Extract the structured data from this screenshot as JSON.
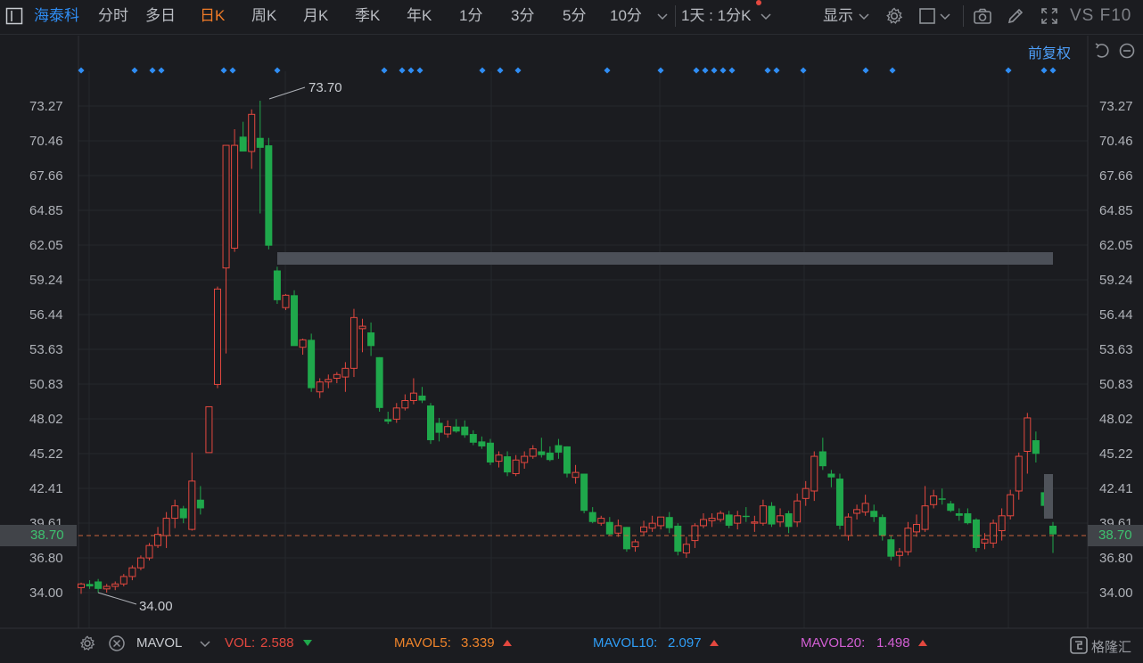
{
  "toolbar": {
    "stock_name": "海泰科",
    "periods": [
      "分时",
      "多日",
      "日K",
      "周K",
      "月K",
      "季K",
      "年K",
      "1分",
      "3分",
      "5分",
      "10分"
    ],
    "active_period": "日K",
    "custom_period": "1天 : 1分K",
    "display_label": "显示",
    "f10_label": "VS F10"
  },
  "adjust_label": "前复权",
  "price_axis": {
    "labels": [
      "73.27",
      "70.46",
      "67.66",
      "64.85",
      "62.05",
      "59.24",
      "56.44",
      "53.63",
      "50.83",
      "48.02",
      "45.22",
      "42.41",
      "39.61",
      "36.80",
      "34.00"
    ]
  },
  "current_price": "38.70",
  "annotations": {
    "high": "73.70",
    "low": "34.00"
  },
  "indicators": {
    "name": "MAVOL",
    "vol_label": "VOL:",
    "vol_value": "2.588",
    "mavol5_label": "MAVOL5:",
    "mavol5_value": "3.339",
    "mavol10_label": "MAVOL10:",
    "mavol10_value": "2.097",
    "mavol20_label": "MAVOL20:",
    "mavol20_value": "1.498",
    "colors": {
      "vol": "#e4483f",
      "mavol5": "#f0842a",
      "mavol10": "#2f9df6",
      "mavol20": "#d35fd4"
    }
  },
  "brand": "格隆汇",
  "colors": {
    "up": "#e4483f",
    "down": "#1fa84b",
    "accent": "#f07b27",
    "blue": "#2f8df4",
    "background": "#1b1c20"
  },
  "chart_data": {
    "type": "candlestick",
    "ylim": [
      34.0,
      73.27
    ],
    "candles": [
      {
        "o": 34.4,
        "h": 34.8,
        "l": 33.9,
        "c": 34.7
      },
      {
        "o": 34.7,
        "h": 35.0,
        "l": 34.3,
        "c": 34.5
      },
      {
        "o": 34.9,
        "h": 35.1,
        "l": 34.0,
        "c": 34.3
      },
      {
        "o": 34.3,
        "h": 34.7,
        "l": 34.0,
        "c": 34.5
      },
      {
        "o": 34.5,
        "h": 34.9,
        "l": 34.2,
        "c": 34.7
      },
      {
        "o": 34.7,
        "h": 35.5,
        "l": 34.5,
        "c": 35.3
      },
      {
        "o": 35.3,
        "h": 36.2,
        "l": 35.0,
        "c": 36.0
      },
      {
        "o": 36.0,
        "h": 37.0,
        "l": 35.8,
        "c": 36.8
      },
      {
        "o": 36.8,
        "h": 38.0,
        "l": 36.6,
        "c": 37.8
      },
      {
        "o": 37.8,
        "h": 39.3,
        "l": 37.6,
        "c": 38.7
      },
      {
        "o": 38.6,
        "h": 40.5,
        "l": 37.6,
        "c": 40.0
      },
      {
        "o": 40.0,
        "h": 41.5,
        "l": 39.2,
        "c": 41.0
      },
      {
        "o": 40.8,
        "h": 41.0,
        "l": 39.6,
        "c": 40.0
      },
      {
        "o": 39.1,
        "h": 45.3,
        "l": 39.0,
        "c": 43.0
      },
      {
        "o": 41.5,
        "h": 42.6,
        "l": 40.3,
        "c": 40.8
      },
      {
        "o": 45.3,
        "h": 49.0,
        "l": 45.3,
        "c": 49.0
      },
      {
        "o": 50.8,
        "h": 58.7,
        "l": 50.5,
        "c": 58.5
      },
      {
        "o": 60.2,
        "h": 70.1,
        "l": 53.3,
        "c": 70.1
      },
      {
        "o": 61.8,
        "h": 71.4,
        "l": 61.5,
        "c": 70.1
      },
      {
        "o": 70.8,
        "h": 72.0,
        "l": 69.9,
        "c": 69.6
      },
      {
        "o": 69.6,
        "h": 73.0,
        "l": 68.2,
        "c": 72.6
      },
      {
        "o": 70.7,
        "h": 73.7,
        "l": 64.6,
        "c": 69.9
      },
      {
        "o": 70.1,
        "h": 70.7,
        "l": 61.7,
        "c": 62.0
      },
      {
        "o": 60.0,
        "h": 60.3,
        "l": 57.3,
        "c": 57.6
      },
      {
        "o": 57.0,
        "h": 58.1,
        "l": 56.8,
        "c": 58.0
      },
      {
        "o": 58.0,
        "h": 58.4,
        "l": 54.0,
        "c": 53.9
      },
      {
        "o": 53.8,
        "h": 54.5,
        "l": 53.2,
        "c": 54.4
      },
      {
        "o": 54.4,
        "h": 54.9,
        "l": 50.2,
        "c": 50.5
      },
      {
        "o": 50.2,
        "h": 51.3,
        "l": 49.7,
        "c": 51.0
      },
      {
        "o": 51.0,
        "h": 51.6,
        "l": 50.5,
        "c": 51.2
      },
      {
        "o": 51.3,
        "h": 51.8,
        "l": 50.9,
        "c": 51.6
      },
      {
        "o": 51.4,
        "h": 52.6,
        "l": 50.2,
        "c": 52.1
      },
      {
        "o": 52.1,
        "h": 56.9,
        "l": 51.4,
        "c": 56.2
      },
      {
        "o": 55.3,
        "h": 56.1,
        "l": 53.4,
        "c": 55.5
      },
      {
        "o": 55.0,
        "h": 55.8,
        "l": 53.1,
        "c": 53.9
      },
      {
        "o": 53.0,
        "h": 53.0,
        "l": 48.6,
        "c": 48.9
      },
      {
        "o": 48.0,
        "h": 48.6,
        "l": 47.6,
        "c": 47.8
      },
      {
        "o": 48.0,
        "h": 49.3,
        "l": 47.7,
        "c": 48.9
      },
      {
        "o": 48.9,
        "h": 50.0,
        "l": 48.7,
        "c": 49.5
      },
      {
        "o": 49.5,
        "h": 51.3,
        "l": 49.2,
        "c": 50.1
      },
      {
        "o": 49.9,
        "h": 50.6,
        "l": 49.3,
        "c": 49.5
      },
      {
        "o": 49.1,
        "h": 49.3,
        "l": 46.0,
        "c": 46.3
      },
      {
        "o": 47.7,
        "h": 48.1,
        "l": 46.2,
        "c": 46.9
      },
      {
        "o": 46.8,
        "h": 47.9,
        "l": 46.5,
        "c": 47.4
      },
      {
        "o": 47.4,
        "h": 48.0,
        "l": 46.9,
        "c": 47.0
      },
      {
        "o": 47.4,
        "h": 47.9,
        "l": 46.5,
        "c": 46.7
      },
      {
        "o": 46.8,
        "h": 47.1,
        "l": 45.9,
        "c": 46.1
      },
      {
        "o": 46.2,
        "h": 46.6,
        "l": 45.6,
        "c": 45.8
      },
      {
        "o": 46.1,
        "h": 46.4,
        "l": 44.3,
        "c": 44.5
      },
      {
        "o": 44.6,
        "h": 45.4,
        "l": 44.1,
        "c": 45.1
      },
      {
        "o": 45.0,
        "h": 45.4,
        "l": 43.4,
        "c": 43.7
      },
      {
        "o": 43.6,
        "h": 45.1,
        "l": 43.4,
        "c": 44.7
      },
      {
        "o": 44.5,
        "h": 45.4,
        "l": 44.0,
        "c": 45.0
      },
      {
        "o": 45.0,
        "h": 45.9,
        "l": 44.8,
        "c": 45.6
      },
      {
        "o": 45.4,
        "h": 46.5,
        "l": 44.9,
        "c": 45.1
      },
      {
        "o": 45.3,
        "h": 45.8,
        "l": 44.6,
        "c": 44.7
      },
      {
        "o": 45.9,
        "h": 46.4,
        "l": 44.8,
        "c": 45.3
      },
      {
        "o": 45.8,
        "h": 45.8,
        "l": 43.3,
        "c": 43.6
      },
      {
        "o": 43.3,
        "h": 44.3,
        "l": 42.8,
        "c": 43.7
      },
      {
        "o": 43.6,
        "h": 43.6,
        "l": 40.4,
        "c": 40.6
      },
      {
        "o": 40.5,
        "h": 40.9,
        "l": 39.6,
        "c": 39.7
      },
      {
        "o": 39.6,
        "h": 40.2,
        "l": 39.4,
        "c": 40.0
      },
      {
        "o": 39.7,
        "h": 40.1,
        "l": 38.6,
        "c": 38.7
      },
      {
        "o": 38.8,
        "h": 39.9,
        "l": 38.5,
        "c": 39.4
      },
      {
        "o": 39.3,
        "h": 39.3,
        "l": 37.3,
        "c": 37.5
      },
      {
        "o": 37.7,
        "h": 38.3,
        "l": 37.3,
        "c": 38.1
      },
      {
        "o": 38.9,
        "h": 39.8,
        "l": 38.6,
        "c": 39.3
      },
      {
        "o": 39.2,
        "h": 40.2,
        "l": 38.9,
        "c": 39.6
      },
      {
        "o": 39.4,
        "h": 40.1,
        "l": 39.1,
        "c": 40.1
      },
      {
        "o": 40.1,
        "h": 40.5,
        "l": 38.8,
        "c": 39.2
      },
      {
        "o": 39.4,
        "h": 39.6,
        "l": 37.0,
        "c": 37.3
      },
      {
        "o": 37.2,
        "h": 38.5,
        "l": 36.8,
        "c": 37.9
      },
      {
        "o": 38.2,
        "h": 39.6,
        "l": 37.6,
        "c": 39.4
      },
      {
        "o": 39.4,
        "h": 40.4,
        "l": 39.2,
        "c": 39.9
      },
      {
        "o": 39.8,
        "h": 40.4,
        "l": 39.3,
        "c": 40.0
      },
      {
        "o": 39.9,
        "h": 40.6,
        "l": 39.7,
        "c": 40.4
      },
      {
        "o": 40.3,
        "h": 40.6,
        "l": 39.2,
        "c": 39.4
      },
      {
        "o": 39.6,
        "h": 40.6,
        "l": 39.1,
        "c": 40.2
      },
      {
        "o": 40.2,
        "h": 40.9,
        "l": 39.7,
        "c": 40.1
      },
      {
        "o": 39.6,
        "h": 40.2,
        "l": 38.9,
        "c": 39.7
      },
      {
        "o": 39.6,
        "h": 41.5,
        "l": 39.4,
        "c": 41.0
      },
      {
        "o": 41.0,
        "h": 41.3,
        "l": 39.3,
        "c": 39.5
      },
      {
        "o": 39.7,
        "h": 40.8,
        "l": 39.3,
        "c": 40.2
      },
      {
        "o": 40.4,
        "h": 40.6,
        "l": 38.8,
        "c": 39.3
      },
      {
        "o": 39.7,
        "h": 42.0,
        "l": 39.3,
        "c": 41.4
      },
      {
        "o": 41.6,
        "h": 43.0,
        "l": 41.0,
        "c": 42.4
      },
      {
        "o": 42.2,
        "h": 45.4,
        "l": 41.4,
        "c": 45.0
      },
      {
        "o": 45.4,
        "h": 46.5,
        "l": 43.9,
        "c": 44.2
      },
      {
        "o": 43.6,
        "h": 43.9,
        "l": 42.5,
        "c": 43.3
      },
      {
        "o": 43.2,
        "h": 43.6,
        "l": 39.1,
        "c": 39.4
      },
      {
        "o": 38.6,
        "h": 40.4,
        "l": 38.2,
        "c": 40.1
      },
      {
        "o": 40.4,
        "h": 41.1,
        "l": 39.9,
        "c": 40.7
      },
      {
        "o": 40.5,
        "h": 41.9,
        "l": 40.2,
        "c": 41.2
      },
      {
        "o": 40.6,
        "h": 41.1,
        "l": 39.7,
        "c": 40.1
      },
      {
        "o": 40.1,
        "h": 40.3,
        "l": 38.2,
        "c": 38.6
      },
      {
        "o": 38.3,
        "h": 38.6,
        "l": 36.6,
        "c": 36.9
      },
      {
        "o": 37.0,
        "h": 37.6,
        "l": 36.1,
        "c": 37.3
      },
      {
        "o": 37.3,
        "h": 39.7,
        "l": 37.0,
        "c": 39.2
      },
      {
        "o": 38.9,
        "h": 40.3,
        "l": 38.5,
        "c": 39.5
      },
      {
        "o": 39.1,
        "h": 42.6,
        "l": 38.9,
        "c": 41.0
      },
      {
        "o": 41.1,
        "h": 42.3,
        "l": 40.8,
        "c": 41.8
      },
      {
        "o": 41.6,
        "h": 42.4,
        "l": 41.1,
        "c": 41.5
      },
      {
        "o": 41.2,
        "h": 41.4,
        "l": 40.5,
        "c": 40.6
      },
      {
        "o": 40.4,
        "h": 40.8,
        "l": 39.8,
        "c": 40.2
      },
      {
        "o": 40.4,
        "h": 40.8,
        "l": 39.5,
        "c": 39.6
      },
      {
        "o": 39.9,
        "h": 40.0,
        "l": 37.3,
        "c": 37.6
      },
      {
        "o": 38.0,
        "h": 38.8,
        "l": 37.5,
        "c": 38.3
      },
      {
        "o": 38.0,
        "h": 39.9,
        "l": 37.6,
        "c": 39.6
      },
      {
        "o": 39.0,
        "h": 40.8,
        "l": 38.2,
        "c": 40.2
      },
      {
        "o": 40.2,
        "h": 42.3,
        "l": 39.9,
        "c": 41.9
      },
      {
        "o": 42.2,
        "h": 45.3,
        "l": 41.5,
        "c": 45.0
      },
      {
        "o": 45.4,
        "h": 48.5,
        "l": 43.6,
        "c": 48.1
      },
      {
        "o": 46.3,
        "h": 47.0,
        "l": 44.5,
        "c": 45.2
      },
      {
        "o": 42.1,
        "h": 42.5,
        "l": 40.2,
        "c": 41.0
      },
      {
        "o": 39.4,
        "h": 39.7,
        "l": 37.2,
        "c": 38.7
      }
    ]
  }
}
